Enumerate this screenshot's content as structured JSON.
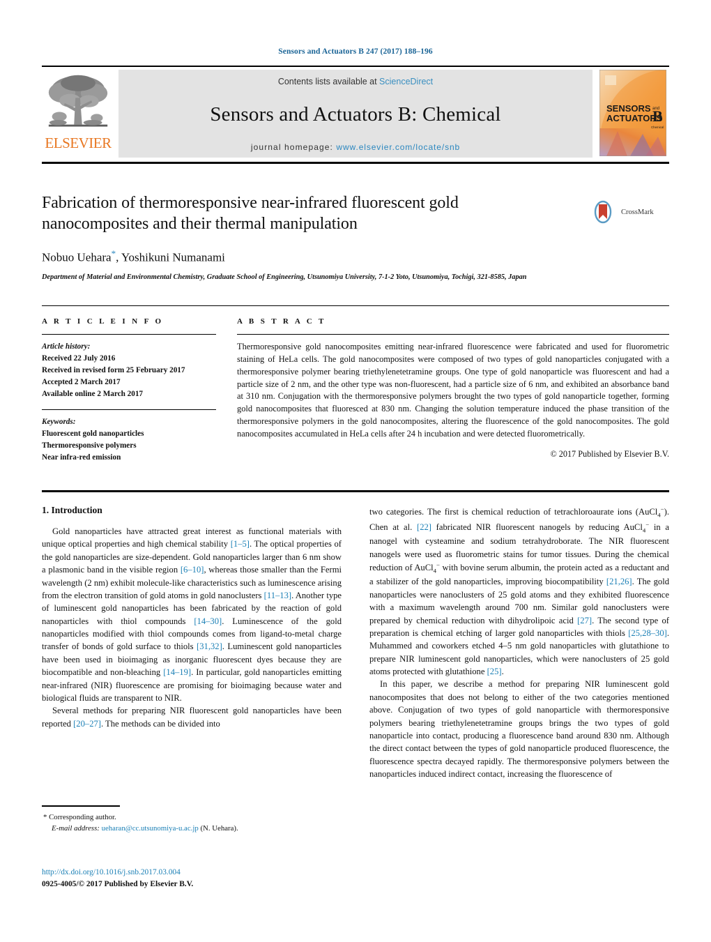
{
  "running_head": "Sensors and Actuators B 247 (2017) 188–196",
  "masthead": {
    "contents_prefix": "Contents lists available at ",
    "sciencedirect": "ScienceDirect",
    "journal_title": "Sensors and Actuators B: Chemical",
    "homepage_prefix": "journal homepage: ",
    "homepage_url": "www.elsevier.com/locate/snb",
    "publisher_name": "ELSEVIER",
    "cover_title_line1": "SENSORS",
    "cover_title_and": "and",
    "cover_title_line2": "ACTUATORS",
    "cover_letter": "B",
    "cover_sub": "Chemical"
  },
  "article": {
    "title": "Fabrication of thermoresponsive near-infrared fluorescent gold nanocomposites and their thermal manipulation",
    "authors_part1": "Nobuo Uehara",
    "authors_star": "*",
    "authors_part2": ", Yoshikuni Numanami",
    "affiliation": "Department of Material and Environmental Chemistry, Graduate School of Engineering, Utsunomiya University, 7-1-2 Yoto, Utsunomiya, Tochigi, 321-8585, Japan",
    "crossmark_label": "CrossMark"
  },
  "article_info": {
    "heading": "A R T I C L E   I N F O",
    "history_label": "Article history:",
    "history": [
      "Received 22 July 2016",
      "Received in revised form 25 February 2017",
      "Accepted 2 March 2017",
      "Available online 2 March 2017"
    ],
    "keywords_label": "Keywords:",
    "keywords": [
      "Fluorescent gold nanoparticles",
      "Thermoresponsive polymers",
      "Near infra-red emission"
    ]
  },
  "abstract": {
    "heading": "A B S T R A C T",
    "text": "Thermoresponsive gold nanocomposites emitting near-infrared fluorescence were fabricated and used for fluorometric staining of HeLa cells. The gold nanocomposites were composed of two types of gold nanoparticles conjugated with a thermoresponsive polymer bearing triethylenetetramine groups. One type of gold nanoparticle was fluorescent and had a particle size of 2 nm, and the other type was non-fluorescent, had a particle size of 6 nm, and exhibited an absorbance band at 310 nm. Conjugation with the thermoresponsive polymers brought the two types of gold nanoparticle together, forming gold nanocomposites that fluoresced at 830 nm. Changing the solution temperature induced the phase transition of the thermoresponsive polymers in the gold nanocomposites, altering the fluorescence of the gold nanocomposites. The gold nanocomposites accumulated in HeLa cells after 24 h incubation and were detected fluorometrically.",
    "copyright": "© 2017 Published by Elsevier B.V."
  },
  "introduction": {
    "section_number_title": "1.  Introduction",
    "left_para_1_a": "Gold nanoparticles have attracted great interest as functional materials with unique optical properties and high chemical stability ",
    "left_para_1_ref1": "[1–5]",
    "left_para_1_b": ". The optical properties of the gold nanoparticles are size-dependent. Gold nanoparticles larger than 6 nm show a plasmonic band in the visible region ",
    "left_para_1_ref2": "[6–10]",
    "left_para_1_c": ", whereas those smaller than the Fermi wavelength (2 nm) exhibit molecule-like characteristics such as luminescence arising from the electron transition of gold atoms in gold nanoclusters ",
    "left_para_1_ref3": "[11–13]",
    "left_para_1_d": ". Another type of luminescent gold nanoparticles has been fabricated by the reaction of gold nanoparticles with thiol compounds ",
    "left_para_1_ref4": "[14–30]",
    "left_para_1_e": ". Luminescence of the gold nanoparticles modified with thiol compounds comes from ligand-to-metal charge transfer of bonds of gold surface to thiols ",
    "left_para_1_ref5": "[31,32]",
    "left_para_1_f": ". Luminescent gold nanoparticles have been used in bioimaging as inorganic fluorescent dyes because they are biocompatible and non-bleaching ",
    "left_para_1_ref6": "[14–19]",
    "left_para_1_g": ". In particular, gold nanoparticles emitting near-infrared (NIR) fluorescence are promising for bioimaging because water and biological fluids are transparent to NIR.",
    "left_para_2_a": "Several methods for preparing NIR fluorescent gold nanoparticles have been reported ",
    "left_para_2_ref1": "[20–27]",
    "left_para_2_b": ". The methods can be divided into",
    "right_para_1_a": "two categories. The first is chemical reduction of tetrachloroaurate ions (AuCl",
    "right_para_1_sub1": "4",
    "right_para_1_sup1": "−",
    "right_para_1_b": "). Chen at al. ",
    "right_para_1_ref1": "[22]",
    "right_para_1_c": " fabricated NIR fluorescent nanogels by reducing AuCl",
    "right_para_1_sub2": "4",
    "right_para_1_sup2": "−",
    "right_para_1_d": " in a nanogel with cysteamine and sodium tetrahydroborate. The NIR fluorescent nanogels were used as fluorometric stains for tumor tissues. During the chemical reduction of AuCl",
    "right_para_1_sub3": "4",
    "right_para_1_sup3": "−",
    "right_para_1_e": " with bovine serum albumin, the protein acted as a reductant and a stabilizer of the gold nanoparticles, improving biocompatibility ",
    "right_para_1_ref2": "[21,26]",
    "right_para_1_f": ". The gold nanoparticles were nanoclusters of 25 gold atoms and they exhibited fluorescence with a maximum wavelength around 700 nm. Similar gold nanoclusters were prepared by chemical reduction with dihydrolipoic acid ",
    "right_para_1_ref3": "[27]",
    "right_para_1_g": ". The second type of preparation is chemical etching of larger gold nanoparticles with thiols ",
    "right_para_1_ref4": "[25,28–30]",
    "right_para_1_h": ". Muhammed and coworkers etched 4–5 nm gold nanoparticles with glutathione to prepare NIR luminescent gold nanoparticles, which were nanoclusters of 25 gold atoms protected with glutathione ",
    "right_para_1_ref5": "[25]",
    "right_para_1_i": ".",
    "right_para_2": "In this paper, we describe a method for preparing NIR luminescent gold nanocomposites that does not belong to either of the two categories mentioned above. Conjugation of two types of gold nanoparticle with thermoresponsive polymers bearing triethylenetetramine groups brings the two types of gold nanoparticle into contact, producing a fluorescence band around 830 nm. Although the direct contact between the types of gold nanoparticle produced fluorescence, the fluorescence spectra decayed rapidly. The thermoresponsive polymers between the nanoparticles induced indirect contact, increasing the fluorescence of"
  },
  "footnote": {
    "corresponding_marker": "*",
    "corresponding_text": "Corresponding author.",
    "email_label": "E-mail address:",
    "email": "ueharan@cc.utsunomiya-u.ac.jp",
    "email_suffix": "(N. Uehara)."
  },
  "footer": {
    "doi": "http://dx.doi.org/10.1016/j.snb.2017.03.004",
    "issn_copyright": "0925-4005/© 2017 Published by Elsevier B.V."
  },
  "colors": {
    "link": "#1a7fb5",
    "running_head": "#1a6496",
    "elsevier_orange": "#E87722",
    "banner_bg": "#e3e3e3"
  }
}
